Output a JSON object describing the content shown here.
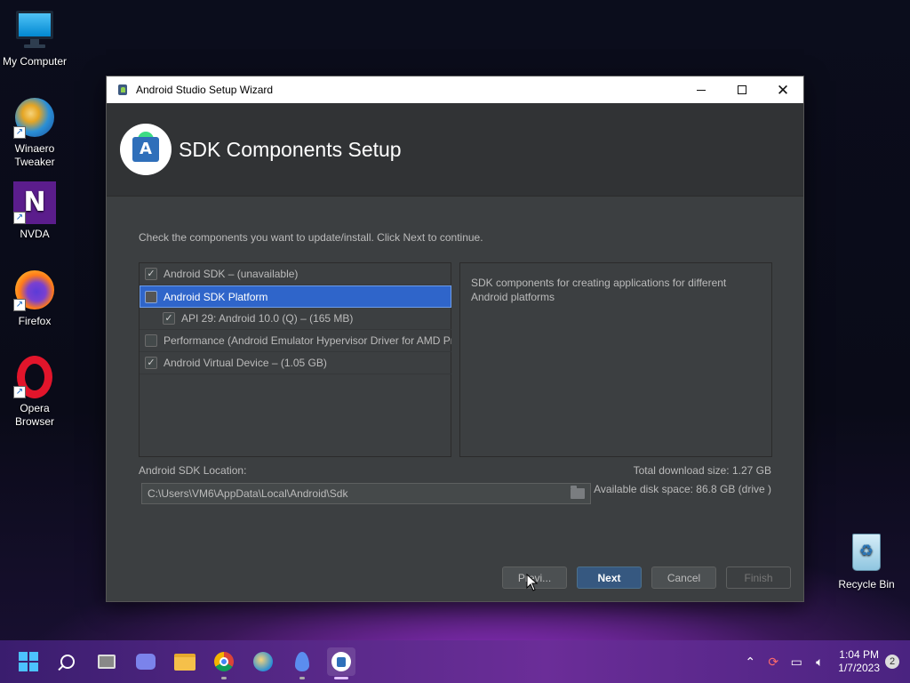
{
  "desktop": {
    "icons": [
      {
        "label_line1": "My Computer",
        "label_line2": ""
      },
      {
        "label_line1": "Winaero",
        "label_line2": "Tweaker"
      },
      {
        "label_line1": "NVDA",
        "label_line2": ""
      },
      {
        "label_line1": "Firefox",
        "label_line2": ""
      },
      {
        "label_line1": "Opera",
        "label_line2": "Browser"
      },
      {
        "label_line1": "Recycle Bin",
        "label_line2": ""
      }
    ]
  },
  "window": {
    "title": "Android Studio Setup Wizard",
    "minimize_glyph": "—",
    "maximize_glyph": "☐",
    "close_glyph": "✕"
  },
  "wizard": {
    "heading": "SDK Components Setup",
    "instruction": "Check the components you want to update/install. Click Next to continue.",
    "components": [
      {
        "label": "Android SDK – (unavailable)",
        "checked": true
      },
      {
        "label": "Android SDK Platform",
        "checked": false,
        "selected": true
      },
      {
        "label": "API 29: Android 10.0 (Q) – (165 MB)",
        "checked": true
      },
      {
        "label": "Performance (Android Emulator Hypervisor Driver for AMD Processors)",
        "checked": false
      },
      {
        "label": "Android Virtual Device – (1.05 GB)",
        "checked": true
      }
    ],
    "description": "SDK components for creating applications for different Android platforms",
    "sdk_location_label": "Android SDK Location:",
    "sdk_location_value": "C:\\Users\\VM6\\AppData\\Local\\Android\\Sdk",
    "total_download": "Total download size: 1.27 GB",
    "available_space": "Available disk space: 86.8 GB (drive )",
    "buttons": {
      "previous": "Previ...",
      "next": "Next",
      "cancel": "Cancel",
      "finish": "Finish"
    }
  },
  "taskbar": {
    "clock_time": "1:04 PM",
    "clock_date": "1/7/2023",
    "notification_count": "2",
    "tray_icons": [
      "chevron-up-icon",
      "sync-icon",
      "network-icon",
      "volume-icon"
    ],
    "pinned": [
      "start-icon",
      "search-icon",
      "task-view-icon",
      "chat-icon",
      "file-explorer-icon",
      "chrome-icon",
      "winaero-icon",
      "drop-icon",
      "android-studio-icon"
    ]
  },
  "colors": {
    "accent": "#365880",
    "selection": "#2f65ca",
    "panel": "#3c3f41",
    "header": "#313335"
  }
}
